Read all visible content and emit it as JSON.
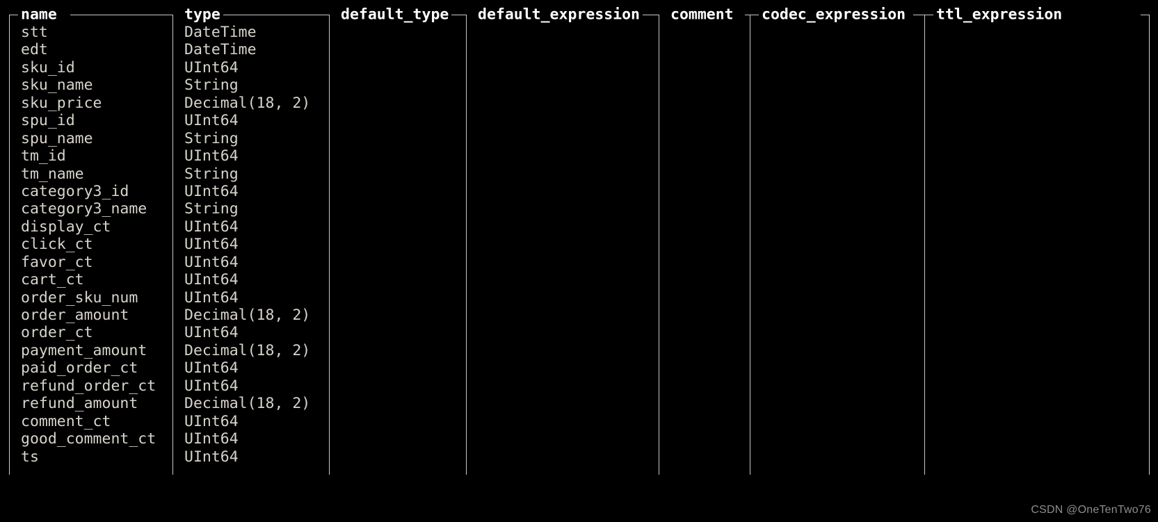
{
  "terminal": {
    "background_color": "#000000",
    "text_color": "#d8d4cc",
    "header_color": "#ffffff",
    "rule_color": "#c8c8c8"
  },
  "table": {
    "columns": [
      {
        "key": "name",
        "label": "name"
      },
      {
        "key": "type",
        "label": "type"
      },
      {
        "key": "default_type",
        "label": "default_type"
      },
      {
        "key": "default_expression",
        "label": "default_expression"
      },
      {
        "key": "comment",
        "label": "comment"
      },
      {
        "key": "codec_expression",
        "label": "codec_expression"
      },
      {
        "key": "ttl_expression",
        "label": "ttl_expression"
      }
    ],
    "rows": [
      {
        "name": "stt",
        "type": "DateTime",
        "default_type": "",
        "default_expression": "",
        "comment": "",
        "codec_expression": "",
        "ttl_expression": ""
      },
      {
        "name": "edt",
        "type": "DateTime",
        "default_type": "",
        "default_expression": "",
        "comment": "",
        "codec_expression": "",
        "ttl_expression": ""
      },
      {
        "name": "sku_id",
        "type": "UInt64",
        "default_type": "",
        "default_expression": "",
        "comment": "",
        "codec_expression": "",
        "ttl_expression": ""
      },
      {
        "name": "sku_name",
        "type": "String",
        "default_type": "",
        "default_expression": "",
        "comment": "",
        "codec_expression": "",
        "ttl_expression": ""
      },
      {
        "name": "sku_price",
        "type": "Decimal(18, 2)",
        "default_type": "",
        "default_expression": "",
        "comment": "",
        "codec_expression": "",
        "ttl_expression": ""
      },
      {
        "name": "spu_id",
        "type": "UInt64",
        "default_type": "",
        "default_expression": "",
        "comment": "",
        "codec_expression": "",
        "ttl_expression": ""
      },
      {
        "name": "spu_name",
        "type": "String",
        "default_type": "",
        "default_expression": "",
        "comment": "",
        "codec_expression": "",
        "ttl_expression": ""
      },
      {
        "name": "tm_id",
        "type": "UInt64",
        "default_type": "",
        "default_expression": "",
        "comment": "",
        "codec_expression": "",
        "ttl_expression": ""
      },
      {
        "name": "tm_name",
        "type": "String",
        "default_type": "",
        "default_expression": "",
        "comment": "",
        "codec_expression": "",
        "ttl_expression": ""
      },
      {
        "name": "category3_id",
        "type": "UInt64",
        "default_type": "",
        "default_expression": "",
        "comment": "",
        "codec_expression": "",
        "ttl_expression": ""
      },
      {
        "name": "category3_name",
        "type": "String",
        "default_type": "",
        "default_expression": "",
        "comment": "",
        "codec_expression": "",
        "ttl_expression": ""
      },
      {
        "name": "display_ct",
        "type": "UInt64",
        "default_type": "",
        "default_expression": "",
        "comment": "",
        "codec_expression": "",
        "ttl_expression": ""
      },
      {
        "name": "click_ct",
        "type": "UInt64",
        "default_type": "",
        "default_expression": "",
        "comment": "",
        "codec_expression": "",
        "ttl_expression": ""
      },
      {
        "name": "favor_ct",
        "type": "UInt64",
        "default_type": "",
        "default_expression": "",
        "comment": "",
        "codec_expression": "",
        "ttl_expression": ""
      },
      {
        "name": "cart_ct",
        "type": "UInt64",
        "default_type": "",
        "default_expression": "",
        "comment": "",
        "codec_expression": "",
        "ttl_expression": ""
      },
      {
        "name": "order_sku_num",
        "type": "UInt64",
        "default_type": "",
        "default_expression": "",
        "comment": "",
        "codec_expression": "",
        "ttl_expression": ""
      },
      {
        "name": "order_amount",
        "type": "Decimal(18, 2)",
        "default_type": "",
        "default_expression": "",
        "comment": "",
        "codec_expression": "",
        "ttl_expression": ""
      },
      {
        "name": "order_ct",
        "type": "UInt64",
        "default_type": "",
        "default_expression": "",
        "comment": "",
        "codec_expression": "",
        "ttl_expression": ""
      },
      {
        "name": "payment_amount",
        "type": "Decimal(18, 2)",
        "default_type": "",
        "default_expression": "",
        "comment": "",
        "codec_expression": "",
        "ttl_expression": ""
      },
      {
        "name": "paid_order_ct",
        "type": "UInt64",
        "default_type": "",
        "default_expression": "",
        "comment": "",
        "codec_expression": "",
        "ttl_expression": ""
      },
      {
        "name": "refund_order_ct",
        "type": "UInt64",
        "default_type": "",
        "default_expression": "",
        "comment": "",
        "codec_expression": "",
        "ttl_expression": ""
      },
      {
        "name": "refund_amount",
        "type": "Decimal(18, 2)",
        "default_type": "",
        "default_expression": "",
        "comment": "",
        "codec_expression": "",
        "ttl_expression": ""
      },
      {
        "name": "comment_ct",
        "type": "UInt64",
        "default_type": "",
        "default_expression": "",
        "comment": "",
        "codec_expression": "",
        "ttl_expression": ""
      },
      {
        "name": "good_comment_ct",
        "type": "UInt64",
        "default_type": "",
        "default_expression": "",
        "comment": "",
        "codec_expression": "",
        "ttl_expression": ""
      },
      {
        "name": "ts",
        "type": "UInt64",
        "default_type": "",
        "default_expression": "",
        "comment": "",
        "codec_expression": "",
        "ttl_expression": ""
      }
    ]
  },
  "watermark": {
    "text": "CSDN @OneTenTwo76"
  }
}
